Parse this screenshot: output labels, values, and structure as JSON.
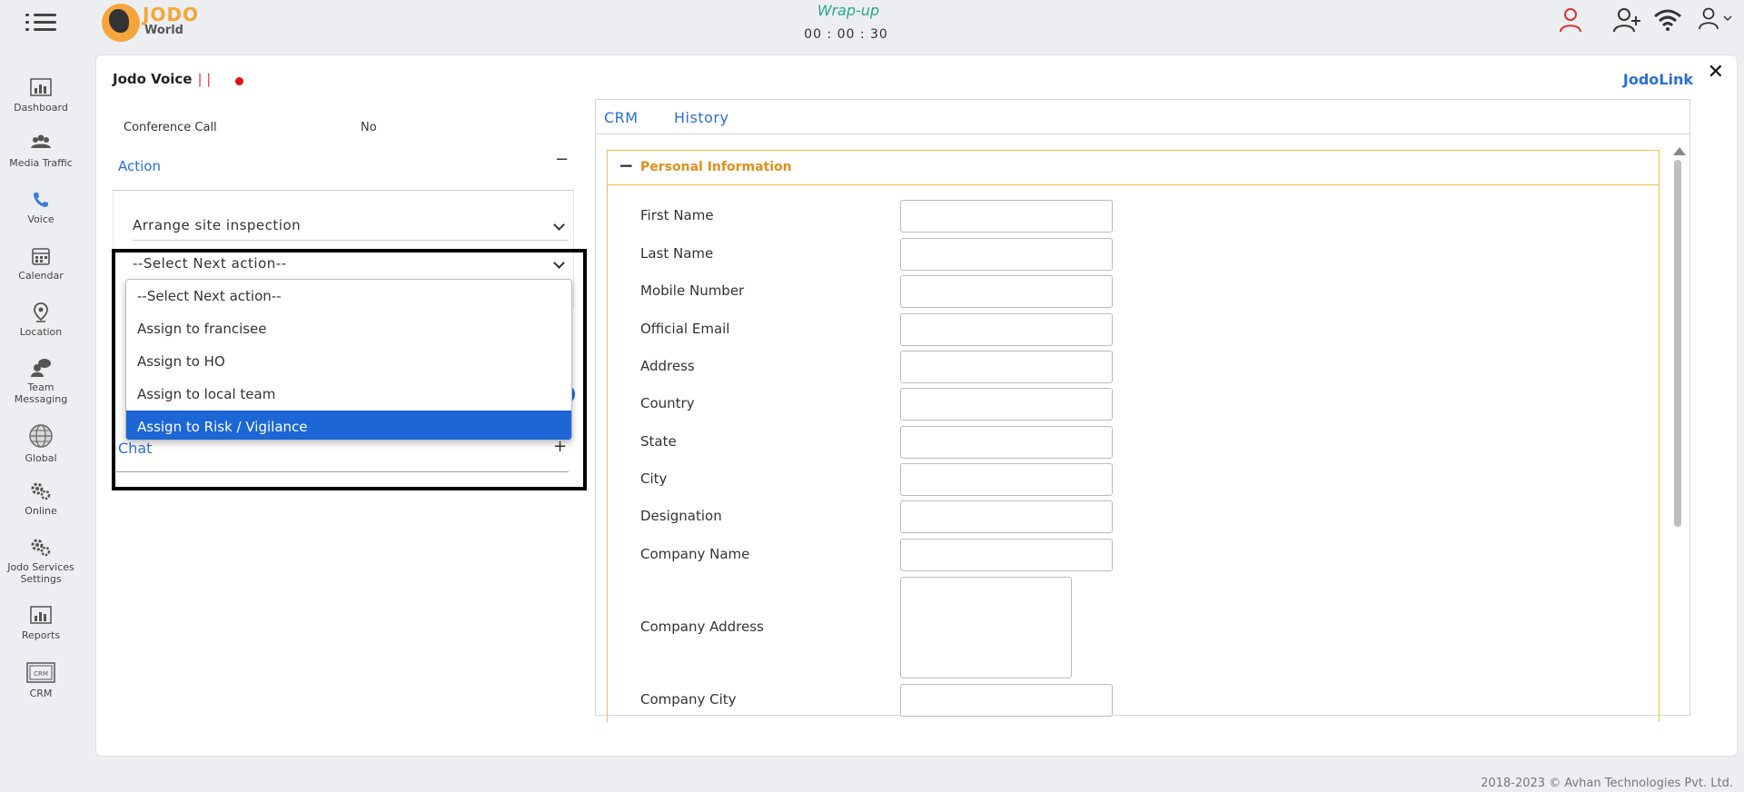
{
  "header": {
    "logo_text_top": "JODO",
    "logo_text_bottom": "World",
    "status": "Wrap-up",
    "timer": "00 : 00 : 30"
  },
  "sidebar": {
    "items": [
      {
        "label": "Dashboard",
        "icon": "dashboard-icon"
      },
      {
        "label": "Media Traffic",
        "icon": "users-icon"
      },
      {
        "label": "Voice",
        "icon": "phone-icon"
      },
      {
        "label": "Calendar",
        "icon": "calendar-icon"
      },
      {
        "label": "Location",
        "icon": "location-pin-icon"
      },
      {
        "label": "Team Messaging",
        "icon": "chat-users-icon"
      },
      {
        "label": "Global",
        "icon": "globe-icon"
      },
      {
        "label": "Online",
        "icon": "gears-icon"
      },
      {
        "label": "Jodo Services Settings",
        "icon": "gears-icon"
      },
      {
        "label": "Reports",
        "icon": "reports-icon"
      },
      {
        "label": "CRM",
        "icon": "crm-icon"
      }
    ]
  },
  "panel": {
    "title": "Jodo Voice",
    "title_bars": "| |",
    "jodolink": "JodoLink",
    "close": "✕"
  },
  "left": {
    "conference_label": "Conference Call",
    "conference_value": "No",
    "action_title": "Action",
    "action_toggle": "−",
    "select_disposition": "Arrange site inspection",
    "select_next_action": "--Select Next action--",
    "dropdown_options": [
      "--Select Next action--",
      "Assign to francisee",
      "Assign to HO",
      "Assign to local team",
      "Assign to Risk / Vigilance"
    ],
    "selected_option": "Assign to Risk / Vigilance",
    "chat_title": "Chat",
    "chat_toggle": "+"
  },
  "crm": {
    "tabs": [
      "CRM",
      "History"
    ],
    "section_title": "Personal Information",
    "section_toggle": "−",
    "fields": [
      "First Name",
      "Last Name",
      "Mobile Number",
      "Official Email",
      "Address",
      "Country",
      "State",
      "City",
      "Designation",
      "Company Name",
      "Company Address",
      "Company City"
    ]
  },
  "footer": {
    "text": "2018-2023 © Avhan Technologies Pvt. Ltd."
  },
  "colors": {
    "accent_blue": "#2a6fd6",
    "selected_blue": "#1c66d6",
    "orange": "#e0901c",
    "wrapup_green": "#29a98b"
  }
}
